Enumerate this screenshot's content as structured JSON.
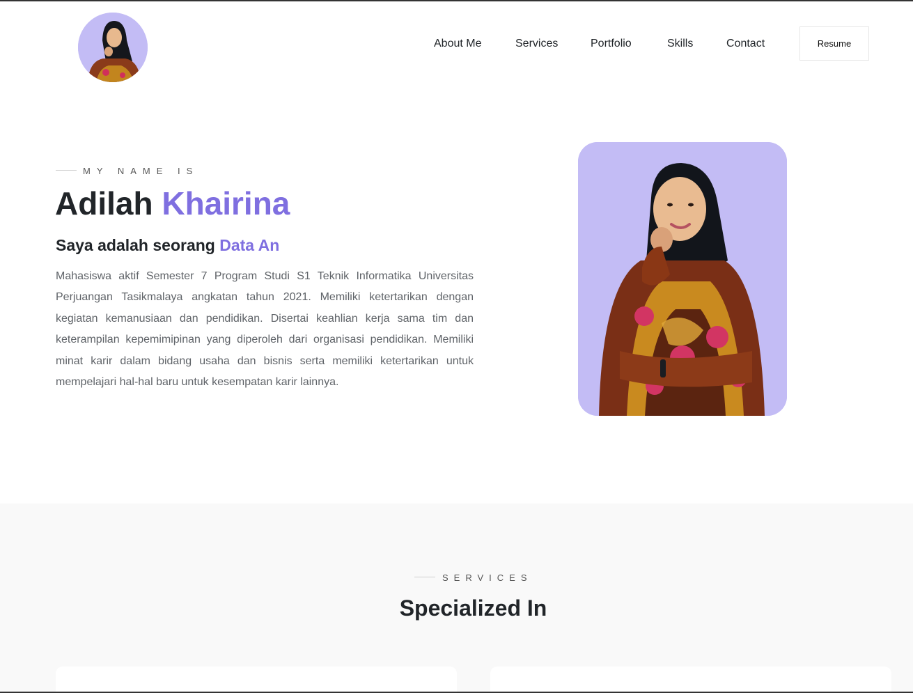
{
  "header": {
    "nav": [
      "About Me",
      "Services",
      "Portfolio",
      "Skills",
      "Contact"
    ],
    "resume_label": "Resume"
  },
  "hero": {
    "eyebrow": "MY NAME IS",
    "first_name": "Adilah",
    "last_name": "Khairina",
    "role_prefix": "Saya adalah seorang",
    "role_typed": "Data An",
    "description": "Mahasiswa aktif Semester 7 Program Studi S1 Teknik Informatika Universitas Perjuangan Tasikmalaya angkatan tahun 2021. Memiliki ketertarikan dengan kegiatan kemanusiaan dan pendidikan. Disertai keahlian kerja sama tim dan keterampilan kepemimipinan yang diperoleh dari organisasi pendidikan. Memiliki minat karir dalam bidang usaha dan bisnis serta memiliki ketertarikan untuk mempelajari hal-hal baru untuk kesempatan karir lainnya."
  },
  "services": {
    "eyebrow": "SERVICES",
    "title": "Specialized In"
  },
  "colors": {
    "accent": "#7f6fe0",
    "photo_bg": "#c3bcf5",
    "section_bg": "#f9f9f9"
  }
}
